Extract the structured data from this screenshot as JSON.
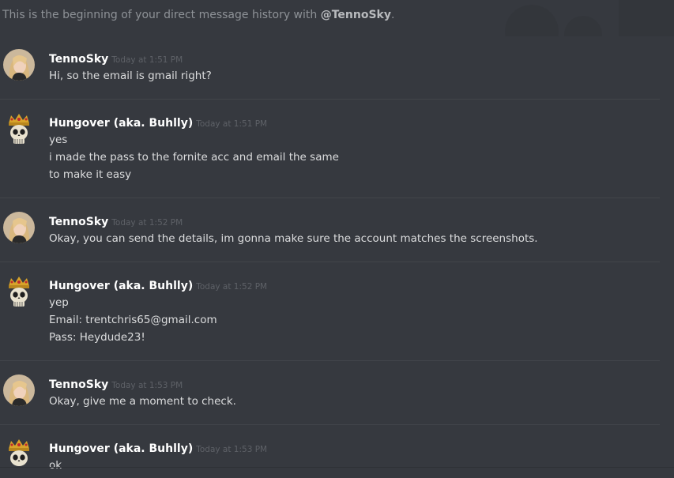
{
  "intro": {
    "prefix": "This is the beginning of your direct message history with ",
    "mention": "@TennoSky",
    "suffix": "."
  },
  "messages": [
    {
      "author": "TennoSky",
      "timestamp": "Today at 1:51 PM",
      "avatar": "blonde-woman-avatar",
      "lines": [
        "Hi, so the email is gmail right?"
      ]
    },
    {
      "author": "Hungover (aka. Buhlly)",
      "timestamp": "Today at 1:51 PM",
      "avatar": "crowned-skull-avatar",
      "lines": [
        "yes",
        "i made the pass to the fornite acc and email the same",
        "to make it easy"
      ]
    },
    {
      "author": "TennoSky",
      "timestamp": "Today at 1:52 PM",
      "avatar": "blonde-woman-avatar",
      "lines": [
        "Okay, you can send the details, im gonna make sure the account matches the screenshots."
      ]
    },
    {
      "author": "Hungover (aka. Buhlly)",
      "timestamp": "Today at 1:52 PM",
      "avatar": "crowned-skull-avatar",
      "lines": [
        "yep",
        "Email: trentchris65@gmail.com",
        "Pass: Heydude23!"
      ]
    },
    {
      "author": "TennoSky",
      "timestamp": "Today at 1:53 PM",
      "avatar": "blonde-woman-avatar",
      "lines": [
        "Okay, give me a moment to check."
      ]
    },
    {
      "author": "Hungover (aka. Buhlly)",
      "timestamp": "Today at 1:53 PM",
      "avatar": "crowned-skull-avatar",
      "lines": [
        "ok"
      ]
    }
  ],
  "colors": {
    "background": "#36393f",
    "author": "#ffffff",
    "message_text": "#dcddde",
    "timestamp": "#5e6167",
    "intro_text": "#8e9297",
    "divider": "#42454a"
  }
}
